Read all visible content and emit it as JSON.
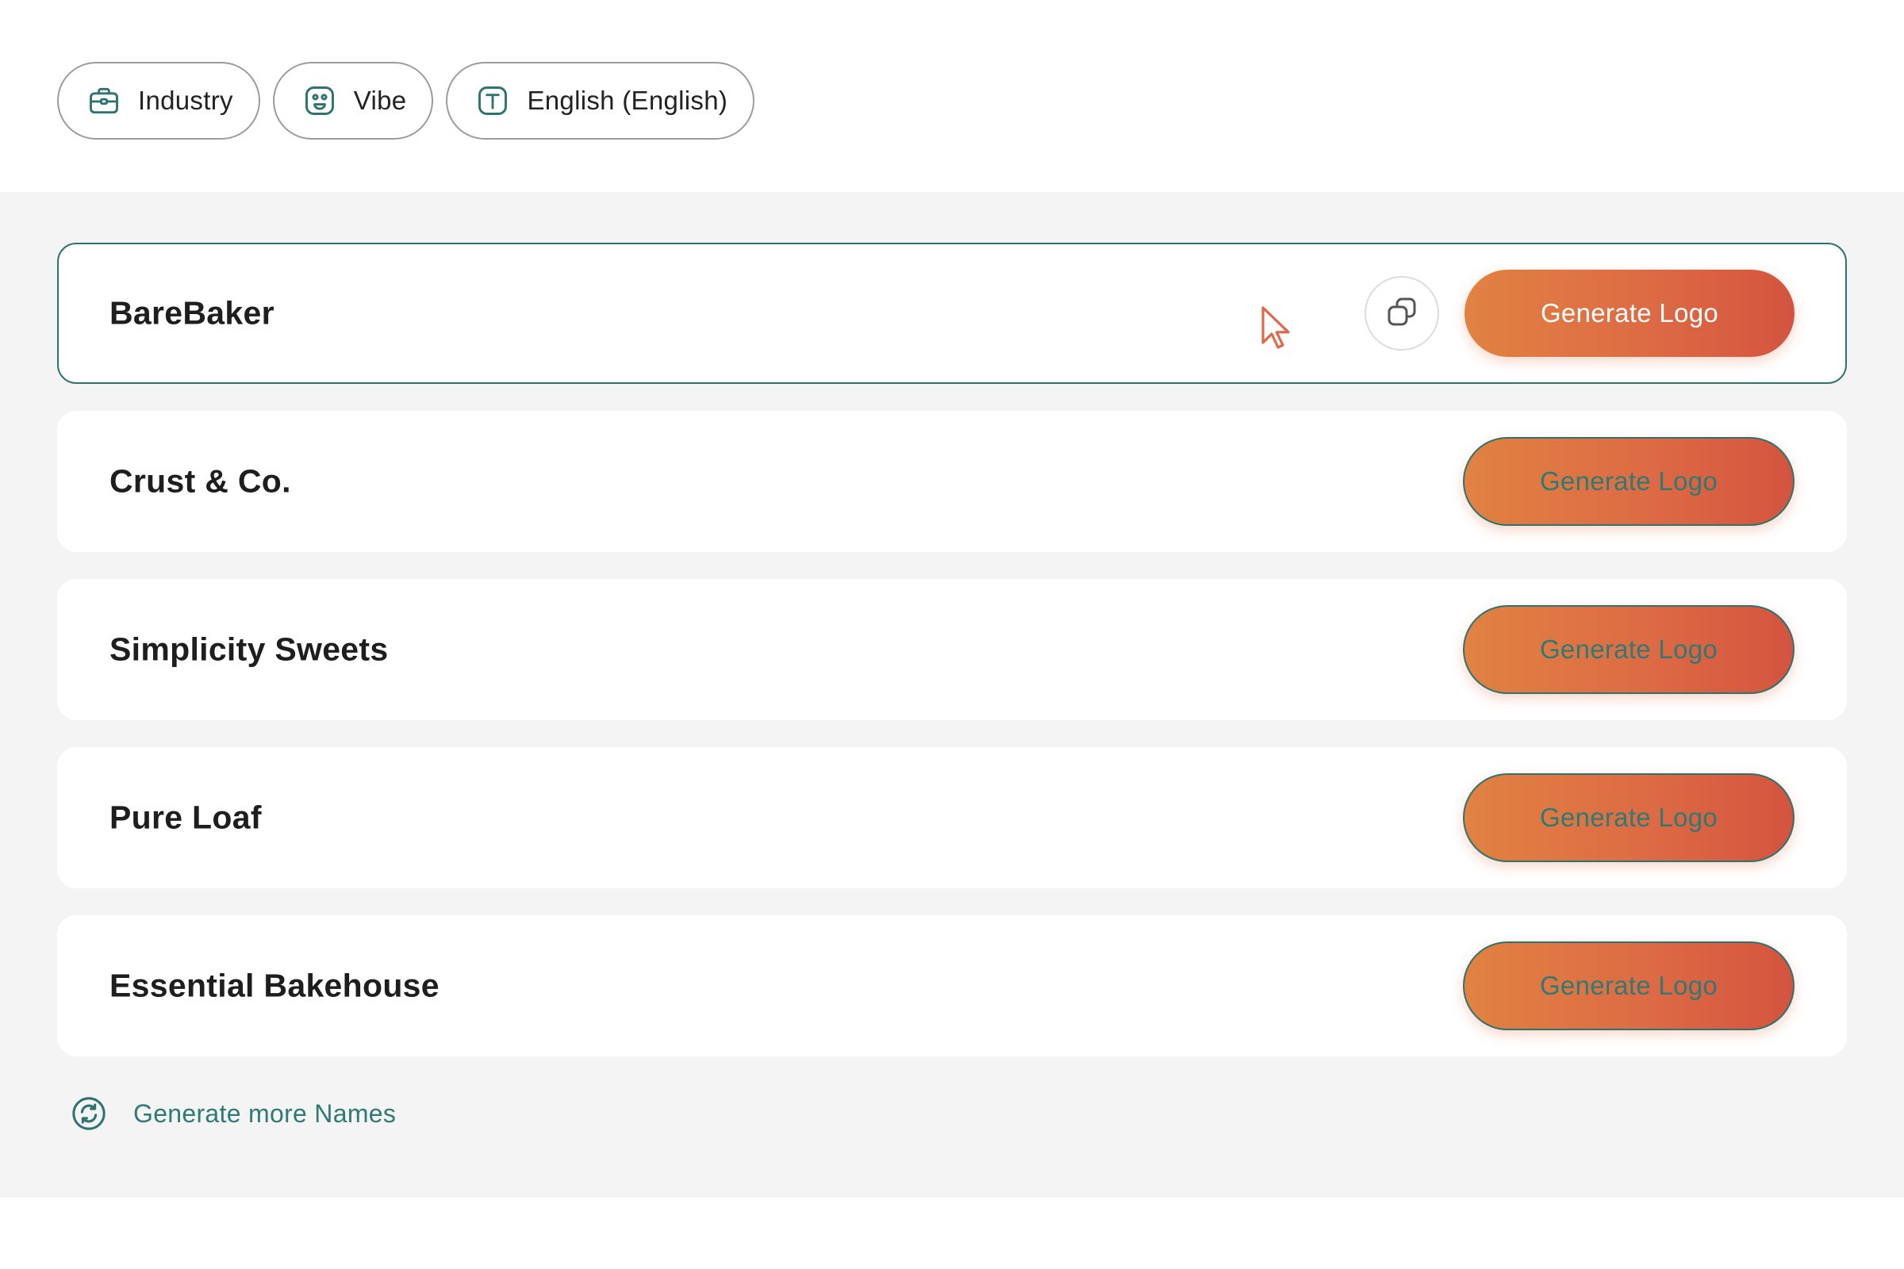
{
  "filters": [
    {
      "label": "Industry",
      "icon": "briefcase-icon"
    },
    {
      "label": "Vibe",
      "icon": "smiley-icon"
    },
    {
      "label": "English (English)",
      "icon": "text-icon"
    }
  ],
  "names": [
    {
      "name": "BareBaker",
      "button": "Generate Logo",
      "active": true
    },
    {
      "name": "Crust & Co.",
      "button": "Generate Logo",
      "active": false
    },
    {
      "name": "Simplicity Sweets",
      "button": "Generate Logo",
      "active": false
    },
    {
      "name": "Pure Loaf",
      "button": "Generate Logo",
      "active": false
    },
    {
      "name": "Essential Bakehouse",
      "button": "Generate Logo",
      "active": false
    }
  ],
  "more": {
    "label": "Generate more Names",
    "icon": "refresh-icon"
  },
  "colors": {
    "accent": "#2f7370",
    "button_gradient_start": "#e18242",
    "button_gradient_end": "#d4543f",
    "background": "#f3f4f3"
  }
}
